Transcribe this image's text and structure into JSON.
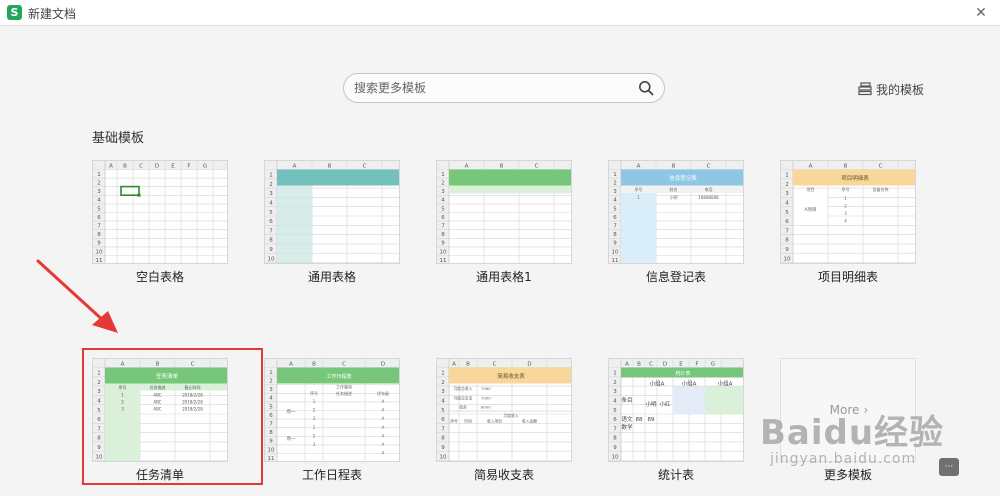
{
  "window": {
    "title": "新建文档",
    "app_icon": "S",
    "close_glyph": "✕"
  },
  "search": {
    "placeholder": "搜索更多模板",
    "value": ""
  },
  "my_templates": {
    "label": "我的模板"
  },
  "section": {
    "title": "基础模板"
  },
  "templates": [
    {
      "label": "空白表格"
    },
    {
      "label": "通用表格"
    },
    {
      "label": "通用表格1"
    },
    {
      "label": "信息登记表"
    },
    {
      "label": "项目明细表"
    },
    {
      "label": "任务清单"
    },
    {
      "label": "工作日程表"
    },
    {
      "label": "简易收支表"
    },
    {
      "label": "统计表"
    },
    {
      "label": "更多模板"
    }
  ],
  "thumb_text": {
    "cols_short": [
      "A",
      "B",
      "C",
      "D",
      "E",
      "F",
      "G"
    ],
    "cols_three": [
      "A",
      "B",
      "C"
    ],
    "info_title": "信息登记表",
    "info_head": [
      "序号",
      "姓名",
      "电话"
    ],
    "info_row": [
      "1",
      "小明",
      "18888888"
    ],
    "proj_title": "项目明细表",
    "proj_head": [
      "项目",
      "序号",
      "设备名称"
    ],
    "proj_item": "A项目",
    "task_title": "任务清单",
    "task_head": [
      "序号",
      "任务描述",
      "截止时间"
    ],
    "task_rows": [
      [
        "1",
        "ABC",
        "2018/2/28"
      ],
      [
        "2",
        "ABC",
        "2018/2/28"
      ],
      [
        "3",
        "ABC",
        "2018/2/28"
      ]
    ],
    "sched_title": "工作日程表",
    "sched_head": [
      "工作事项",
      "序号",
      "任务描述",
      "优先级"
    ],
    "sched_days": [
      "周一",
      "周一"
    ],
    "sched_prio": "A",
    "budget_title": "简易收支表",
    "budget_labels": [
      "月度总收入",
      "月度总支出",
      "结余"
    ],
    "budget_values": [
      "7060",
      "7000",
      "8000"
    ],
    "budget_sub": "月度收入",
    "budget_head": [
      "序号",
      "时间",
      "收入项目",
      "收入金额"
    ],
    "stats_title": "统计表",
    "stats_groups": [
      "小组A",
      "小组A",
      "小组A"
    ],
    "stats_item": "条目",
    "stats_names": [
      "小明",
      "小红"
    ],
    "stats_subjects": [
      "语文",
      "数学"
    ],
    "stats_scores": [
      "88",
      "89"
    ],
    "more_text": "More",
    "more_glyph": "›"
  },
  "colors": {
    "teal_header": "#74c0bc",
    "teal_col": "#d8ecea",
    "green_header": "#77c77a",
    "green_light": "#daf0d8",
    "blue_header": "#8ec7e3",
    "blue_light": "#d9eef8",
    "orange_header": "#f9d79a",
    "selection": "#2e8b2e",
    "highlight_red": "#e53935"
  },
  "watermark": {
    "logo": "Baidu经验",
    "url": "jingyan.baidu.com"
  }
}
